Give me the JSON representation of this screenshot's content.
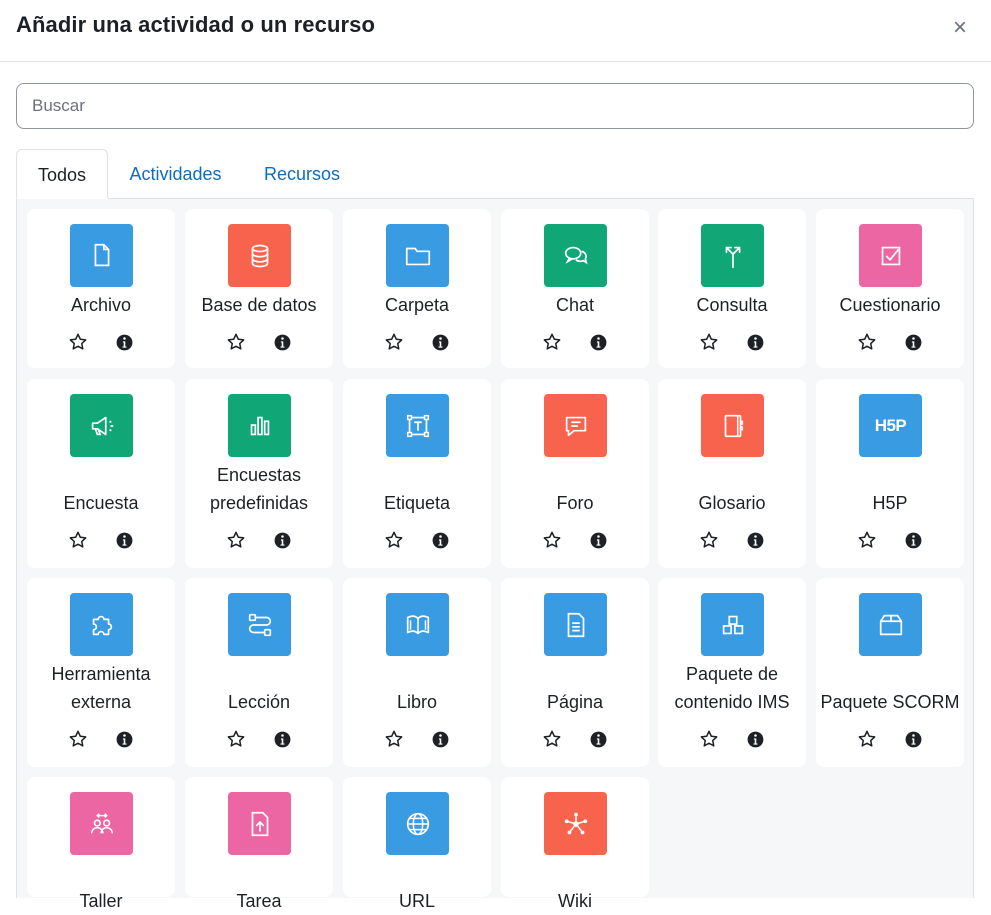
{
  "modal": {
    "title": "Añadir una actividad o un recurso",
    "close_symbol": "×"
  },
  "search": {
    "placeholder": "Buscar",
    "value": ""
  },
  "tabs": [
    {
      "label": "Todos",
      "active": true
    },
    {
      "label": "Actividades",
      "active": false
    },
    {
      "label": "Recursos",
      "active": false
    }
  ],
  "colors": {
    "blue": "#399be2",
    "red": "#f7634d",
    "green": "#11a676",
    "pink": "#eb66a2",
    "link": "#0f6cbf"
  },
  "modules": [
    {
      "name": "Archivo",
      "icon": "file-icon",
      "color": "blue"
    },
    {
      "name": "Base de datos",
      "icon": "database-icon",
      "color": "red"
    },
    {
      "name": "Carpeta",
      "icon": "folder-icon",
      "color": "blue"
    },
    {
      "name": "Chat",
      "icon": "chat-icon",
      "color": "green"
    },
    {
      "name": "Consulta",
      "icon": "signpost-icon",
      "color": "green"
    },
    {
      "name": "Cuestionario",
      "icon": "quiz-icon",
      "color": "pink"
    },
    {
      "name": "Encuesta",
      "icon": "megaphone-icon",
      "color": "green"
    },
    {
      "name": "Encuestas predefinidas",
      "icon": "bar-chart-icon",
      "color": "green"
    },
    {
      "name": "Etiqueta",
      "icon": "text-box-icon",
      "color": "blue"
    },
    {
      "name": "Foro",
      "icon": "forum-icon",
      "color": "red"
    },
    {
      "name": "Glosario",
      "icon": "glossary-icon",
      "color": "red"
    },
    {
      "name": "H5P",
      "icon": "h5p-icon",
      "color": "blue",
      "glyph": "H5P"
    },
    {
      "name": "Herramienta externa",
      "icon": "puzzle-icon",
      "color": "blue"
    },
    {
      "name": "Lección",
      "icon": "route-icon",
      "color": "blue"
    },
    {
      "name": "Libro",
      "icon": "book-icon",
      "color": "blue"
    },
    {
      "name": "Página",
      "icon": "page-icon",
      "color": "blue"
    },
    {
      "name": "Paquete de contenido IMS",
      "icon": "blocks-icon",
      "color": "blue"
    },
    {
      "name": "Paquete SCORM",
      "icon": "package-icon",
      "color": "blue"
    },
    {
      "name": "Taller",
      "icon": "workshop-icon",
      "color": "pink"
    },
    {
      "name": "Tarea",
      "icon": "assignment-icon",
      "color": "pink"
    },
    {
      "name": "URL",
      "icon": "globe-icon",
      "color": "blue"
    },
    {
      "name": "Wiki",
      "icon": "wiki-icon",
      "color": "red"
    }
  ],
  "card_actions": {
    "favourite_icon": "star-icon",
    "info_icon": "info-icon"
  }
}
